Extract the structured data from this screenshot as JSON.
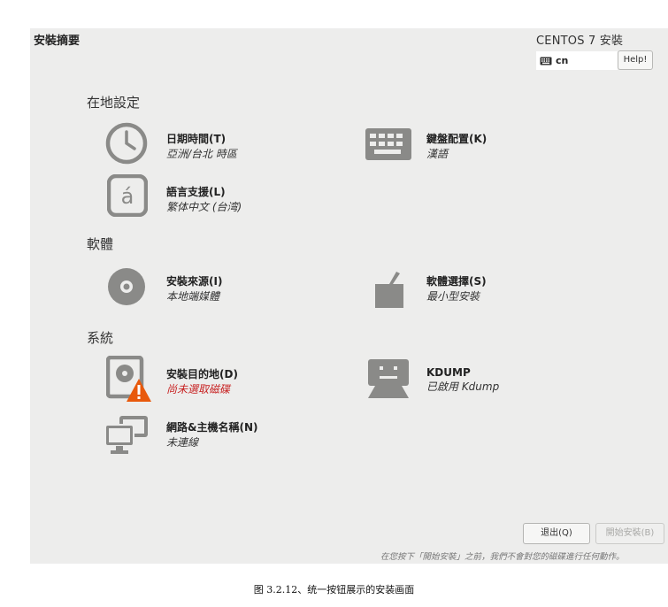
{
  "header": {
    "title": "安裝摘要",
    "product": "CENTOS 7 安裝",
    "help_label": "Help!"
  },
  "keyboard": {
    "layout": "cn",
    "icon": "keyboard-icon"
  },
  "sections": {
    "localization": {
      "title": "在地設定",
      "datetime": {
        "title": "日期時間(T)",
        "subtitle": "亞洲/台北 時區",
        "icon": "clock-icon"
      },
      "keyboard": {
        "title": "鍵盤配置(K)",
        "subtitle": "漢語",
        "icon": "keyboard-icon"
      },
      "language": {
        "title": "語言支援(L)",
        "subtitle": "繁体中文 (台湾)",
        "icon": "language-icon"
      }
    },
    "software": {
      "title": "軟體",
      "source": {
        "title": "安裝來源(I)",
        "subtitle": "本地端媒體",
        "icon": "disc-icon"
      },
      "selection": {
        "title": "軟體選擇(S)",
        "subtitle": "最小型安裝",
        "icon": "package-icon"
      }
    },
    "system": {
      "title": "系統",
      "destination": {
        "title": "安裝目的地(D)",
        "subtitle": "尚未選取磁碟",
        "icon": "harddisk-warning-icon",
        "status_color": "#c71f1f"
      },
      "kdump": {
        "title": "KDUMP",
        "subtitle": "已啟用 Kdump",
        "icon": "kdump-icon"
      },
      "network": {
        "title": "網路&主機名稱(N)",
        "subtitle": "未連線",
        "icon": "network-icon"
      }
    }
  },
  "footer": {
    "quit_label": "退出(Q)",
    "begin_label": "開始安裝(B)",
    "note": "在您按下「開始安裝」之前，我們不會對您的磁碟進行任何動作。"
  },
  "caption": "图 3.2.12、统一按钮展示的安装画面",
  "colors": {
    "panel": "#ededec",
    "icon_gray": "#8a8a88",
    "warning": "#e8590c",
    "error_text": "#c71f1f"
  }
}
